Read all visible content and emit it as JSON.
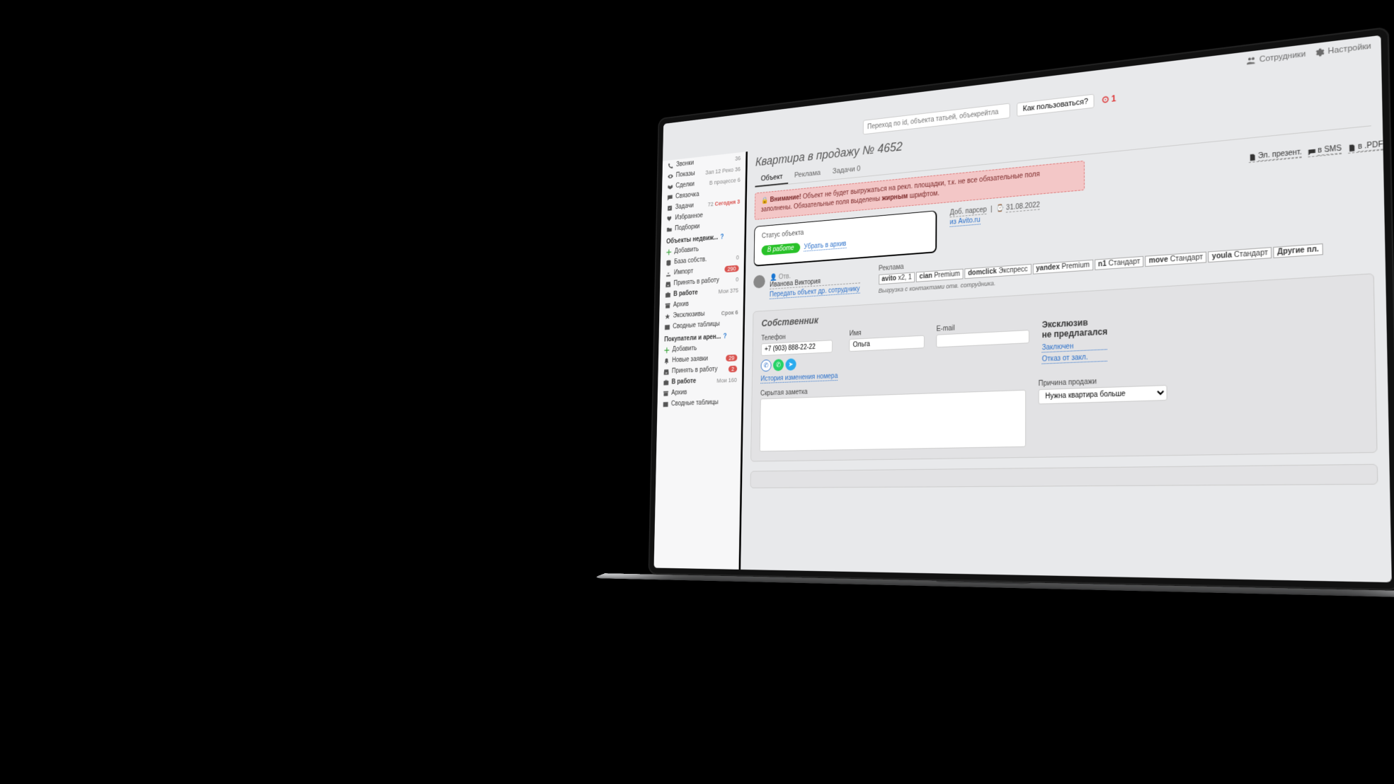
{
  "topbar": {
    "employees": "Сотрудники",
    "settings": "Настройки"
  },
  "search": {
    "placeholder": "Переход по id, объекта татьей, объекрейтла",
    "how_to": "Как пользоваться?",
    "aim_count": "1"
  },
  "sidebar": {
    "nav": [
      {
        "icon": "calls",
        "label": "Звонки",
        "right": "36"
      },
      {
        "icon": "shows",
        "label": "Показы",
        "right": "Зап 12  Реко 36"
      },
      {
        "icon": "deals",
        "label": "Сделки",
        "right": "В процессе 6"
      },
      {
        "icon": "chat",
        "label": "Связочка",
        "right": ""
      },
      {
        "icon": "tasks",
        "label": "Задачи",
        "right_pre": "72",
        "right_red": "Сегодня 3"
      },
      {
        "icon": "heart",
        "label": "Избранное",
        "right": ""
      },
      {
        "icon": "pick",
        "label": "Подборки",
        "right": ""
      }
    ],
    "sec1_title": "Объекты недвиж...",
    "sec1": [
      {
        "icon": "plus",
        "label": "Добавить"
      },
      {
        "icon": "db",
        "label": "База собств.",
        "right": "0"
      },
      {
        "icon": "import",
        "label": "Импорт",
        "badge": "290"
      },
      {
        "icon": "take",
        "label": "Принять в работу",
        "right": "0"
      },
      {
        "icon": "briefcase",
        "label": "В работе",
        "right": "Мои 375",
        "active": true
      },
      {
        "icon": "archive",
        "label": "Архив"
      },
      {
        "icon": "excl",
        "label": "Эксклюзивы",
        "right_red": "Срок 6"
      },
      {
        "icon": "pivot",
        "label": "Сводные таблицы"
      }
    ],
    "sec2_title": "Покупатели и арен...",
    "sec2": [
      {
        "icon": "plus",
        "label": "Добавить"
      },
      {
        "icon": "new",
        "label": "Новые заявки",
        "badge": "29"
      },
      {
        "icon": "take",
        "label": "Принять в работу",
        "badge": "2"
      },
      {
        "icon": "briefcase",
        "label": "В работе",
        "right": "Мои 160",
        "active": true
      },
      {
        "icon": "archive",
        "label": "Архив"
      },
      {
        "icon": "pivot",
        "label": "Сводные таблицы"
      }
    ]
  },
  "page": {
    "title": "Квартира в продажу № 4652",
    "tabs": {
      "object": "Объект",
      "ads": "Реклама",
      "tasks": "Задачи 0"
    },
    "alert_b1": "Внимание!",
    "alert_t1": "Объект не будет выгружаться на рекл. площадки, т.к. не все обязательные поля заполнены.",
    "alert_t2": "Обязательные поля выделены",
    "alert_b2": "жирным",
    "alert_t3": "шрифтом.",
    "status_label": "Статус объекта",
    "status_pill": "В работе",
    "status_archive": "Убрать в архив",
    "meta_added": "Доб. парсер",
    "meta_date_icon": "⌚",
    "meta_date": "31.08.2022",
    "meta_source": "из Avito.ru",
    "export_present": "Эл. презент.",
    "export_sms": "в SMS",
    "export_pdf": "в .PDF",
    "user_dept": "Отв.",
    "user_name": "Иванова Виктория",
    "user_transfer": "Передать объект др. сотруднику",
    "ads_header": "Реклама",
    "ads_chips": [
      {
        "b": "avito",
        "t": " x2, 1"
      },
      {
        "b": "cian",
        "t": " Premium"
      },
      {
        "b": "domclick",
        "t": " Экспресс"
      },
      {
        "b": "yandex",
        "t": " Premium"
      },
      {
        "b": "n1",
        "t": " Стандарт"
      },
      {
        "b": "move",
        "t": " Стандарт"
      },
      {
        "b": "youla",
        "t": " Стандарт"
      },
      {
        "b": "Другие пл.",
        "t": ""
      }
    ],
    "ads_note": "Выгрузка с контактами отв. сотрудника.",
    "owner_header": "Собственник",
    "owner_phone_label": "Телефон",
    "owner_phone": "+7 (903) 888-22-22",
    "owner_name_label": "Имя",
    "owner_name": "Ольга",
    "owner_email_label": "E-mail",
    "owner_email": "",
    "excl_line1": "Эксклюзив",
    "excl_line2": "не предлагался",
    "excl_link1": "Заключен",
    "excl_link2": "Отказ от закл.",
    "history_link": "История изменения номера",
    "secret_label": "Скрытая заметка",
    "reason_label": "Причина продажи",
    "reason_value": "Нужна квартира больше"
  }
}
